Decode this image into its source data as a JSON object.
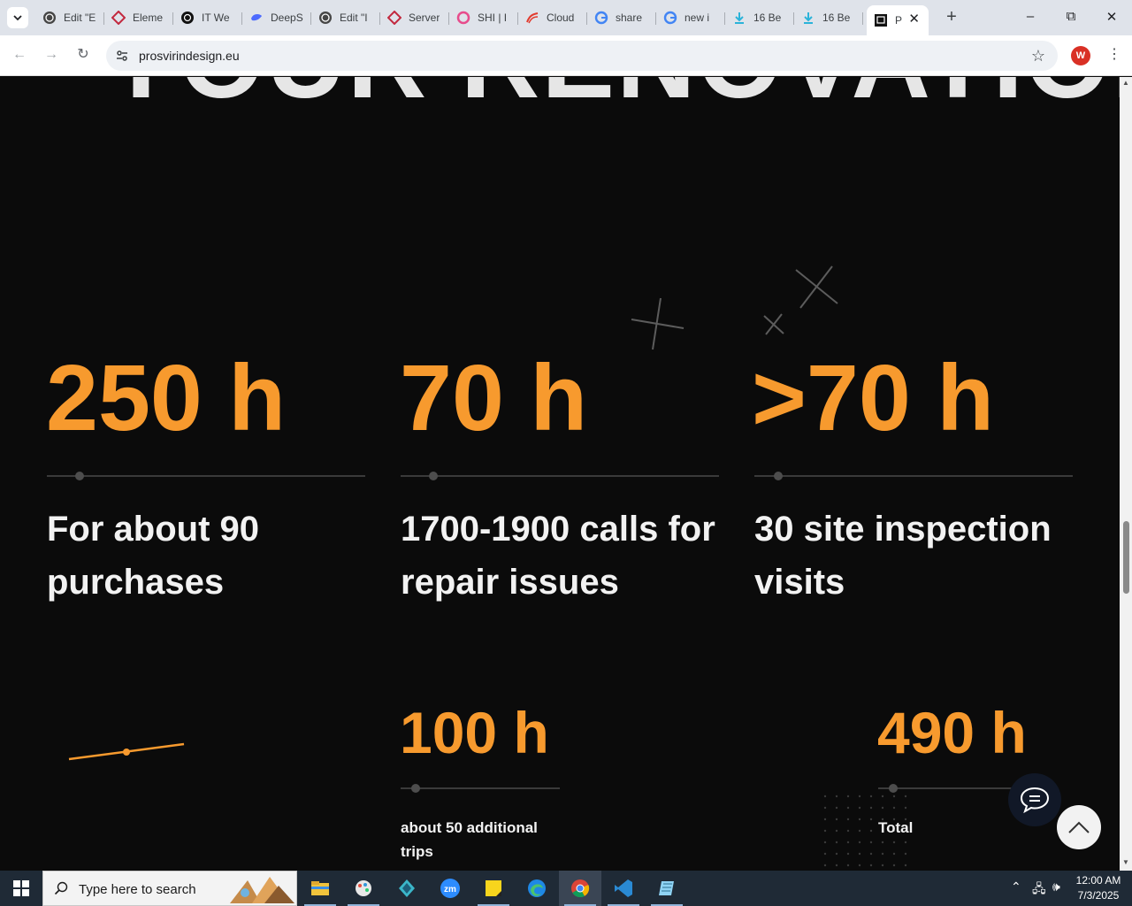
{
  "browser": {
    "tabs": [
      {
        "title": "Edit \"E",
        "icon": "wordpress-icon"
      },
      {
        "title": "Eleme",
        "icon": "elementor-icon"
      },
      {
        "title": "IT We",
        "icon": "openai-icon"
      },
      {
        "title": "DeepS",
        "icon": "deepseek-icon"
      },
      {
        "title": "Edit \"I",
        "icon": "wordpress-icon"
      },
      {
        "title": "Server",
        "icon": "elementor-icon"
      },
      {
        "title": "SHI | I",
        "icon": "circle-logo-icon"
      },
      {
        "title": "Cloud",
        "icon": "cloud-icon"
      },
      {
        "title": "share",
        "icon": "google-icon"
      },
      {
        "title": "new i",
        "icon": "google-icon"
      },
      {
        "title": "16 Be",
        "icon": "download-arrow-icon"
      },
      {
        "title": "16 Be",
        "icon": "download-arrow-icon"
      }
    ],
    "active_tab": {
      "title": "P",
      "icon": "site-favicon-icon"
    },
    "url": "prosvirindesign.eu",
    "profile_initial": "W"
  },
  "page": {
    "heading": "YOUR RENOVATION",
    "stats": [
      {
        "value": "250 h",
        "desc": "For about 90 purchases"
      },
      {
        "value": "70 h",
        "desc": "1700-1900 calls for repair issues"
      },
      {
        "value": ">70 h",
        "desc": "30 site inspection visits"
      }
    ],
    "stats_bottom": [
      {
        "value": "100 h",
        "desc": "about 50 additional trips"
      },
      {
        "value": "490 h",
        "desc": "Total"
      }
    ],
    "accent_color": "#f79a2e"
  },
  "taskbar": {
    "search_placeholder": "Type here to search",
    "time": "12:00 AM",
    "date": "7/3/2025"
  }
}
